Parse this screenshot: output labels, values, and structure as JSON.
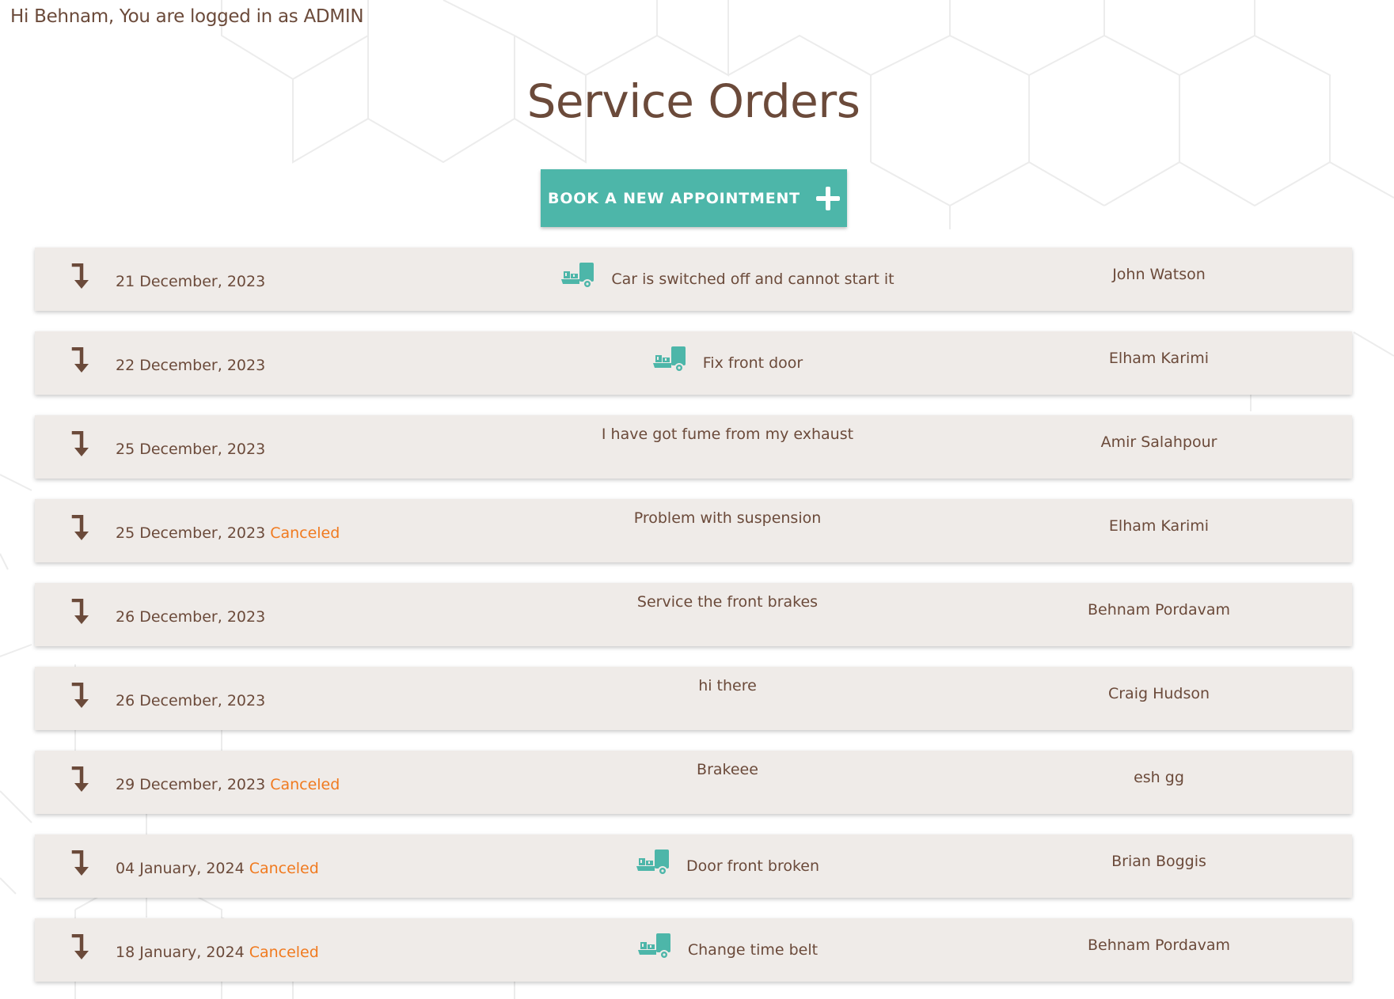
{
  "header": {
    "greeting": "Hi Behnam, You are logged in as ADMIN",
    "title": "Service Orders",
    "book_label": "BOOK A NEW APPOINTMENT"
  },
  "colors": {
    "accent": "#4db6a9",
    "text": "#6b4a3a",
    "canceled": "#f07a1f",
    "row_bg": "#efebe8"
  },
  "orders": [
    {
      "date": "21 December, 2023",
      "status": "",
      "description": "Car is switched off and cannot start it",
      "customer": "John Watson",
      "icon": "delivery-truck-icon"
    },
    {
      "date": "22 December, 2023",
      "status": "",
      "description": "Fix front door",
      "customer": "Elham Karimi",
      "icon": "delivery-truck-icon"
    },
    {
      "date": "25 December, 2023",
      "status": "",
      "description": "I have got fume from my exhaust",
      "customer": "Amir Salahpour",
      "icon": ""
    },
    {
      "date": "25 December, 2023",
      "status": "Canceled",
      "description": "Problem with suspension",
      "customer": "Elham Karimi",
      "icon": ""
    },
    {
      "date": "26 December, 2023",
      "status": "",
      "description": "Service the front brakes",
      "customer": "Behnam Pordavam",
      "icon": ""
    },
    {
      "date": "26 December, 2023",
      "status": "",
      "description": "hi there",
      "customer": "Craig Hudson",
      "icon": ""
    },
    {
      "date": "29 December, 2023",
      "status": "Canceled",
      "description": "Brakeee",
      "customer": "esh gg",
      "icon": ""
    },
    {
      "date": "04 January, 2024",
      "status": "Canceled",
      "description": "Door front broken",
      "customer": "Brian Boggis",
      "icon": "delivery-truck-icon"
    },
    {
      "date": "18 January, 2024",
      "status": "Canceled",
      "description": "Change time belt",
      "customer": "Behnam Pordavam",
      "icon": "delivery-truck-icon"
    }
  ]
}
